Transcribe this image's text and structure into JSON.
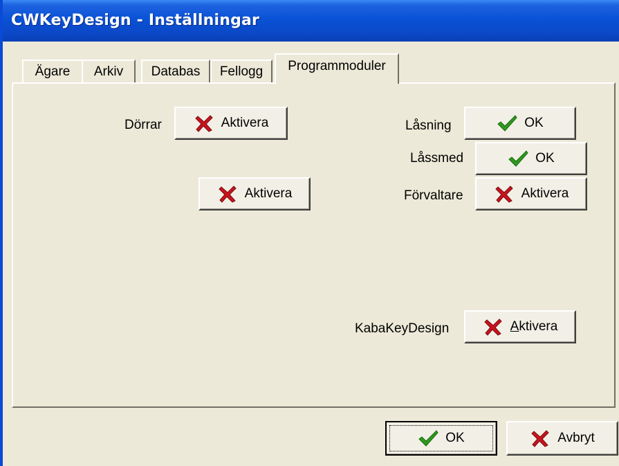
{
  "window": {
    "title": "CWKeyDesign - Inställningar"
  },
  "tabs": [
    {
      "label": "Ägare"
    },
    {
      "label": "Arkiv"
    },
    {
      "label": "Databas"
    },
    {
      "label": "Fellogg"
    },
    {
      "label": "Programmoduler",
      "active": true
    }
  ],
  "modules": {
    "dorrar": {
      "label": "Dörrar",
      "button": "Aktivera",
      "status_icon": "x-icon"
    },
    "unnamed": {
      "button": "Aktivera",
      "status_icon": "x-icon"
    },
    "lasning": {
      "label": "Låsning",
      "button": "OK",
      "status_icon": "checkmark-icon"
    },
    "lassmed": {
      "label": "Låssmed",
      "button": "OK",
      "status_icon": "checkmark-icon"
    },
    "forvaltare": {
      "label": "Förvaltare",
      "button": "Aktivera",
      "status_icon": "x-icon"
    },
    "kabakeydesign": {
      "label": "KabaKeyDesign",
      "button": "Aktivera",
      "status_icon": "x-icon"
    }
  },
  "footer": {
    "ok_label": "OK",
    "cancel_label": "Avbryt"
  },
  "colors": {
    "titlebar": "#0A52D6",
    "face": "#ECE9D8",
    "check_green": "#2E9A1E",
    "x_red": "#C8141E"
  }
}
